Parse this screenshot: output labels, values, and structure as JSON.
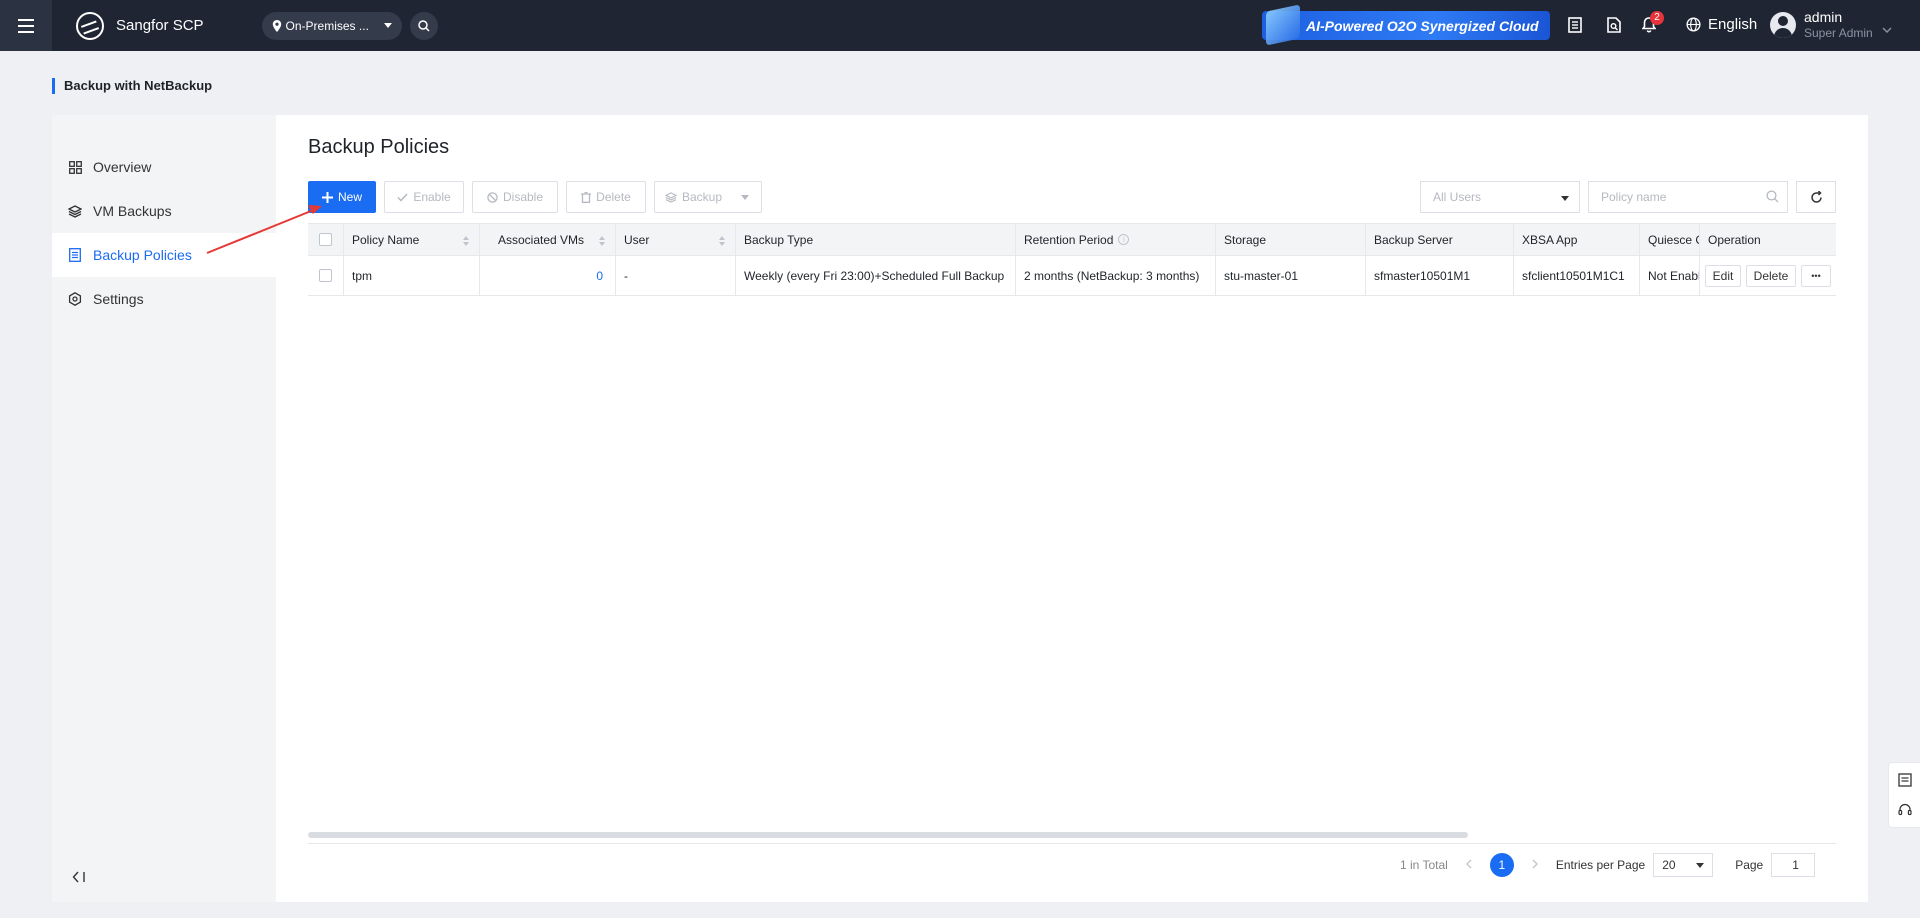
{
  "topbar": {
    "app_name": "Sangfor SCP",
    "region": "On-Premises ...",
    "banner_text": "AI-Powered O2O Synergized Cloud",
    "notification_count": "2",
    "language": "English",
    "user_name": "admin",
    "user_role": "Super Admin"
  },
  "page": {
    "header": "Backup with NetBackup",
    "title": "Backup Policies"
  },
  "sidebar": {
    "items": [
      {
        "label": "Overview",
        "icon": "grid-icon"
      },
      {
        "label": "VM Backups",
        "icon": "layers-icon"
      },
      {
        "label": "Backup Policies",
        "icon": "policy-doc-icon",
        "active": true
      },
      {
        "label": "Settings",
        "icon": "gear-icon"
      }
    ],
    "collapse_icon": "collapse-sidebar-icon"
  },
  "toolbar": {
    "new": "New",
    "enable": "Enable",
    "disable": "Disable",
    "delete": "Delete",
    "backup": "Backup",
    "users_filter": "All Users",
    "search_placeholder": "Policy name"
  },
  "table": {
    "columns": [
      "Policy Name",
      "Associated VMs",
      "User",
      "Backup Type",
      "Retention Period",
      "Storage",
      "Backup Server",
      "XBSA App",
      "Quiesce G",
      "Operation"
    ],
    "rows": [
      {
        "policy_name": "tpm",
        "associated_vms": "0",
        "user": "-",
        "backup_type": "Weekly (every Fri 23:00)+Scheduled Full Backup",
        "retention_period": "2 months (NetBackup: 3 months)",
        "storage": "stu-master-01",
        "backup_server": "sfmaster10501M1",
        "xbsa_app": "sfclient10501M1C1",
        "quiesce": "Not Enable",
        "op_edit": "Edit",
        "op_delete": "Delete",
        "op_more": "•••"
      }
    ]
  },
  "pagination": {
    "total": "1 in Total",
    "current_page": "1",
    "entries_label": "Entries per Page",
    "entries_value": "20",
    "page_label": "Page",
    "page_value": "1"
  },
  "colors": {
    "accent": "#1a6cf2",
    "topbar": "#1f2533",
    "annotation_arrow": "#e53935"
  }
}
